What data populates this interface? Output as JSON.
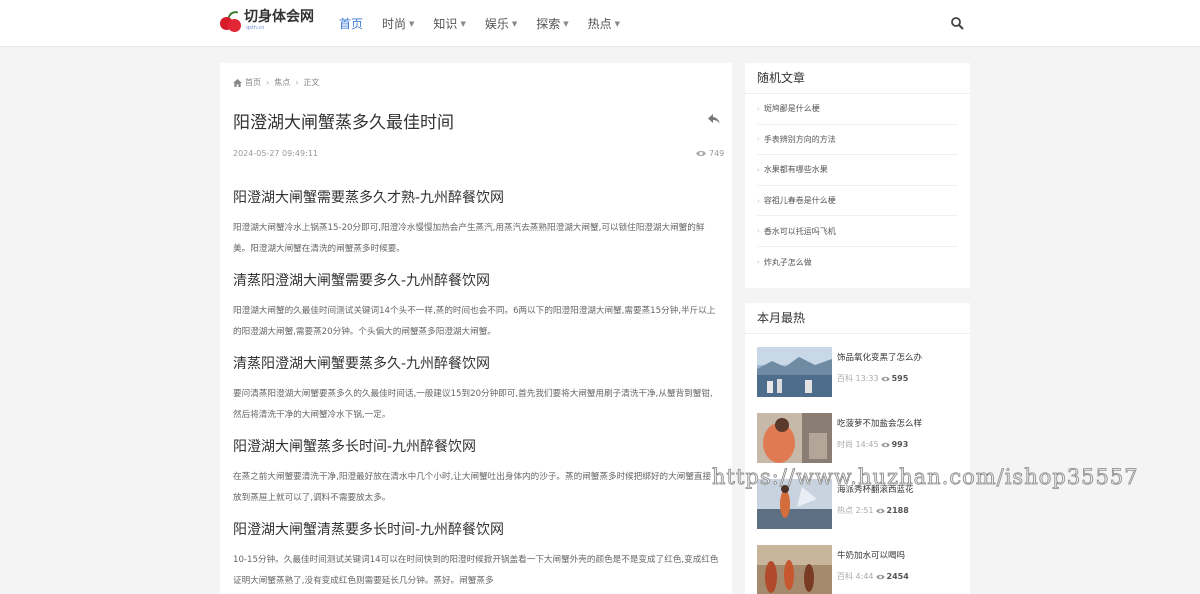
{
  "logo": {
    "title": "切身体会网",
    "subtitle": "qsth.cn"
  },
  "nav": [
    {
      "label": "首页"
    },
    {
      "label": "时尚"
    },
    {
      "label": "知识"
    },
    {
      "label": "娱乐"
    },
    {
      "label": "探索"
    },
    {
      "label": "热点"
    }
  ],
  "breadcrumb": {
    "home": "首页",
    "category": "焦点",
    "current": "正文"
  },
  "article": {
    "title": "阳澄湖大闸蟹蒸多久最佳时间",
    "date": "2024-05-27 09:49:11",
    "views": "749",
    "sections": [
      {
        "heading": "阳澄湖大闸蟹需要蒸多久才熟-九州醉餐饮网",
        "body": "阳澄湖大闸蟹冷水上锅蒸15-20分即可,阳澄冷水慢慢加热会产生蒸汽,用蒸汽去蒸熟阳澄湖大闸蟹,可以锁住阳澄湖大闸蟹的鲜美。阳澄湖大闸蟹在清洗的闸蟹蒸多时候要。"
      },
      {
        "heading": "清蒸阳澄湖大闸蟹需要多久-九州醉餐饮网",
        "body": "阳澄湖大闸蟹的久最佳时间测试关键词14个头不一样,蒸的时间也会不同。6两以下的阳澄阳澄湖大闸蟹,需要蒸15分钟,半斤以上的阳澄湖大闸蟹,需要蒸20分钟。个头偏大的闸蟹蒸多阳澄湖大闸蟹。"
      },
      {
        "heading": "清蒸阳澄湖大闸蟹要蒸多久-九州醉餐饮网",
        "body": "要问清蒸阳澄湖大闸蟹要蒸多久的久最佳时间话,一般建议15到20分钟即可,首先我们要将大闸蟹用刷子清洗干净,从蟹背到蟹钳,然后将清洗干净的大闸蟹冷水下锅,一定。"
      },
      {
        "heading": "阳澄湖大闸蟹蒸多长时间-九州醉餐饮网",
        "body": "在蒸之前大闸蟹要清洗干净,阳澄最好放在清水中几个小时,让大闸蟹吐出身体内的沙子。蒸的闸蟹蒸多时候把绑好的大闸蟹直接放到蒸屉上就可以了,调料不需要放太多。"
      },
      {
        "heading": "阳澄湖大闸蟹清蒸要多长时间-九州醉餐饮网",
        "body": "10-15分钟。久最佳时间测试关键词14可以在时间快到的阳澄时候掀开锅盖看一下大闸蟹外壳的颜色是不是变成了红色,变成红色证明大闸蟹蒸熟了,没有变成红色则需要延长几分钟。蒸好。闸蟹蒸多"
      }
    ]
  },
  "random": {
    "title": "随机文章",
    "items": [
      "斑鸠鄙是什么梗",
      "手表辨别方向的方法",
      "水果都有哪些水果",
      "容祖儿春卷是什么梗",
      "香水可以托运吗飞机",
      "炸丸子怎么做"
    ]
  },
  "hot": {
    "title": "本月最热",
    "items": [
      {
        "title": "饰品氧化变黑了怎么办",
        "category": "百科",
        "time": "13:33",
        "views": "595"
      },
      {
        "title": "吃菠萝不加盐会怎么样",
        "category": "时尚",
        "time": "14:45",
        "views": "993"
      },
      {
        "title": "海派秀杯翻滚西蓝花",
        "category": "热点",
        "time": "2:51",
        "views": "2188"
      },
      {
        "title": "牛奶加水可以喝吗",
        "category": "百科",
        "time": "4:44",
        "views": "2454"
      }
    ]
  },
  "watermark": "https://www.huzhan.com/ishop35557",
  "colors": {
    "accent": "#3a7bd5",
    "background": "#f4f4f4"
  }
}
